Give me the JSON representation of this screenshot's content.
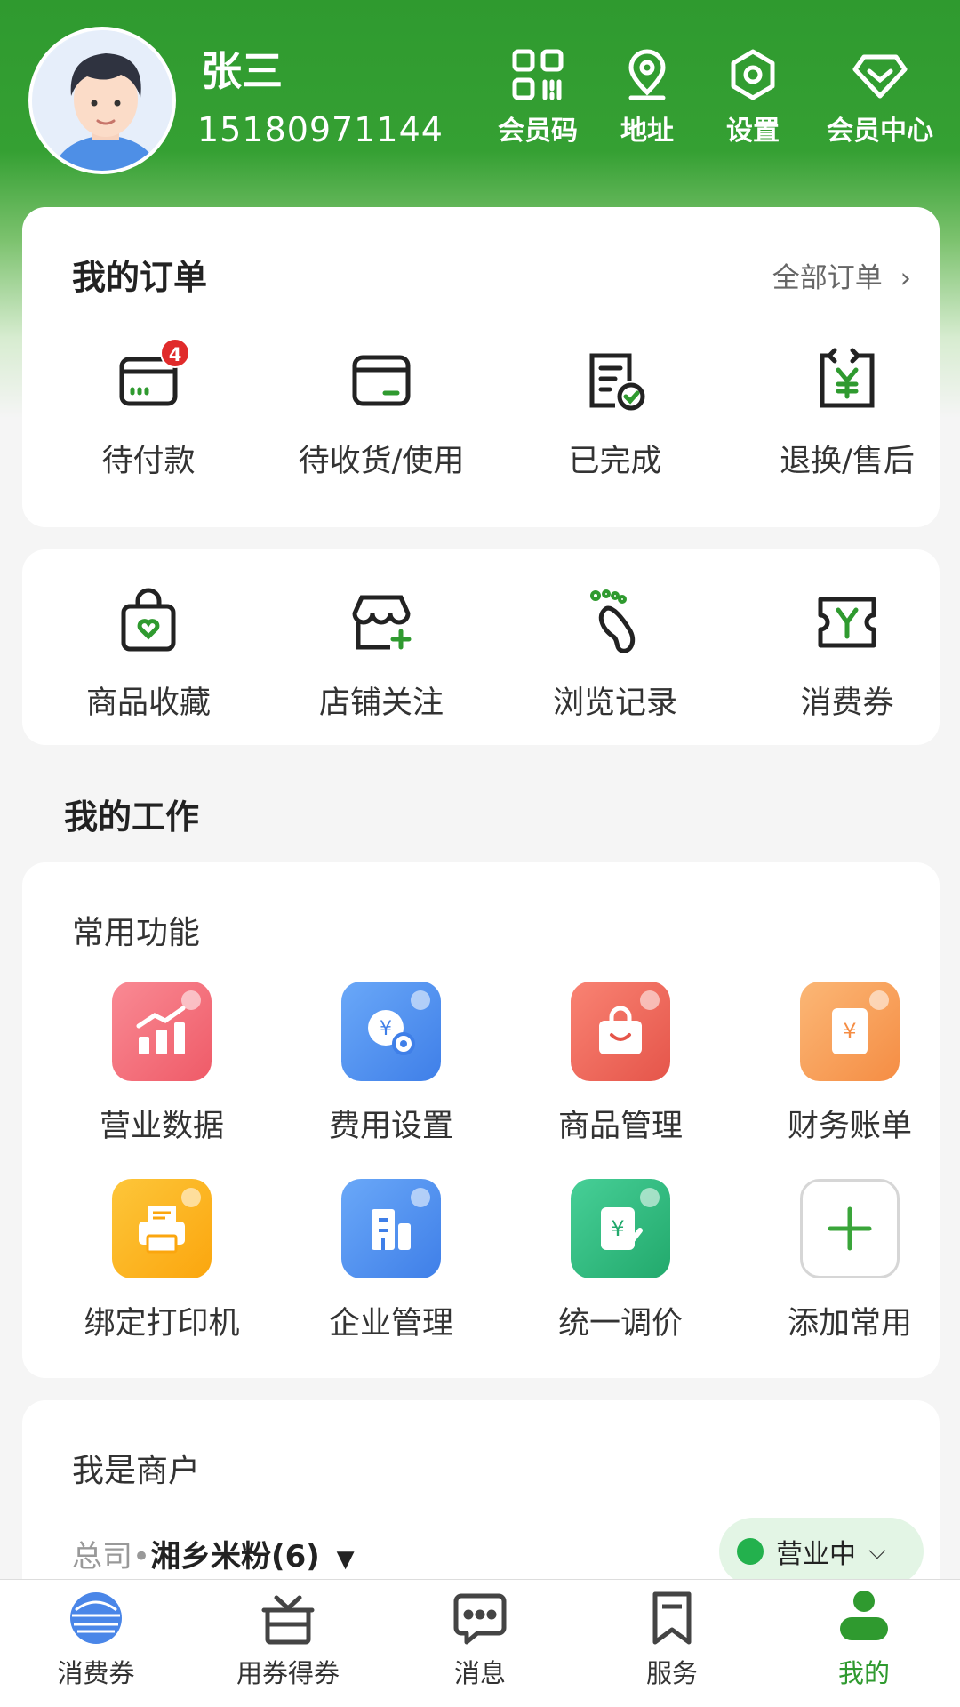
{
  "user": {
    "name": "张三",
    "phone": "15180971144"
  },
  "header_actions": [
    {
      "label": "会员码",
      "icon": "qr-code-icon"
    },
    {
      "label": "地址",
      "icon": "location-pin-icon"
    },
    {
      "label": "设置",
      "icon": "settings-hex-icon"
    },
    {
      "label": "会员中心",
      "icon": "diamond-icon"
    }
  ],
  "orders": {
    "title": "我的订单",
    "all_link": "全部订单",
    "items": [
      {
        "label": "待付款",
        "icon": "wallet-card-icon",
        "badge": "4"
      },
      {
        "label": "待收货/使用",
        "icon": "wallet-icon"
      },
      {
        "label": "已完成",
        "icon": "doc-check-icon"
      },
      {
        "label": "退换/售后",
        "icon": "refund-yen-icon"
      }
    ]
  },
  "favorites": {
    "items": [
      {
        "label": "商品收藏",
        "icon": "shopping-bag-heart-icon"
      },
      {
        "label": "店铺关注",
        "icon": "store-plus-icon"
      },
      {
        "label": "浏览记录",
        "icon": "footprint-icon"
      },
      {
        "label": "消费券",
        "icon": "coupon-y-icon"
      }
    ]
  },
  "work": {
    "title": "我的工作",
    "common_title": "常用功能",
    "items": [
      {
        "label": "营业数据",
        "icon": "bar-chart-icon",
        "color": "#f36b78"
      },
      {
        "label": "费用设置",
        "icon": "fee-settings-icon",
        "color": "#4a8ff2"
      },
      {
        "label": "商品管理",
        "icon": "bag-icon",
        "color": "#ec5f52"
      },
      {
        "label": "财务账单",
        "icon": "bill-icon",
        "color": "#f6a25a"
      },
      {
        "label": "绑定打印机",
        "icon": "printer-icon",
        "color": "#fbb31c"
      },
      {
        "label": "企业管理",
        "icon": "building-icon",
        "color": "#4a8ff2"
      },
      {
        "label": "统一调价",
        "icon": "price-edit-icon",
        "color": "#2fbe83"
      },
      {
        "label": "添加常用",
        "icon": "plus-icon",
        "color": "#3aa53a"
      }
    ]
  },
  "merchant": {
    "title": "我是商户",
    "company_prefix": "总司",
    "company_name": "湘乡米粉(6)",
    "status": "营业中"
  },
  "tabs": [
    {
      "label": "消费券",
      "icon": "coupon-globe-icon",
      "active": false
    },
    {
      "label": "用券得券",
      "icon": "gift-box-icon",
      "active": false
    },
    {
      "label": "消息",
      "icon": "message-icon",
      "active": false
    },
    {
      "label": "服务",
      "icon": "bookmark-icon",
      "active": false
    },
    {
      "label": "我的",
      "icon": "person-icon",
      "active": true
    }
  ],
  "colors": {
    "brand": "#2f9a2f",
    "badge": "#e02b2b",
    "status_dot": "#23b14d"
  }
}
